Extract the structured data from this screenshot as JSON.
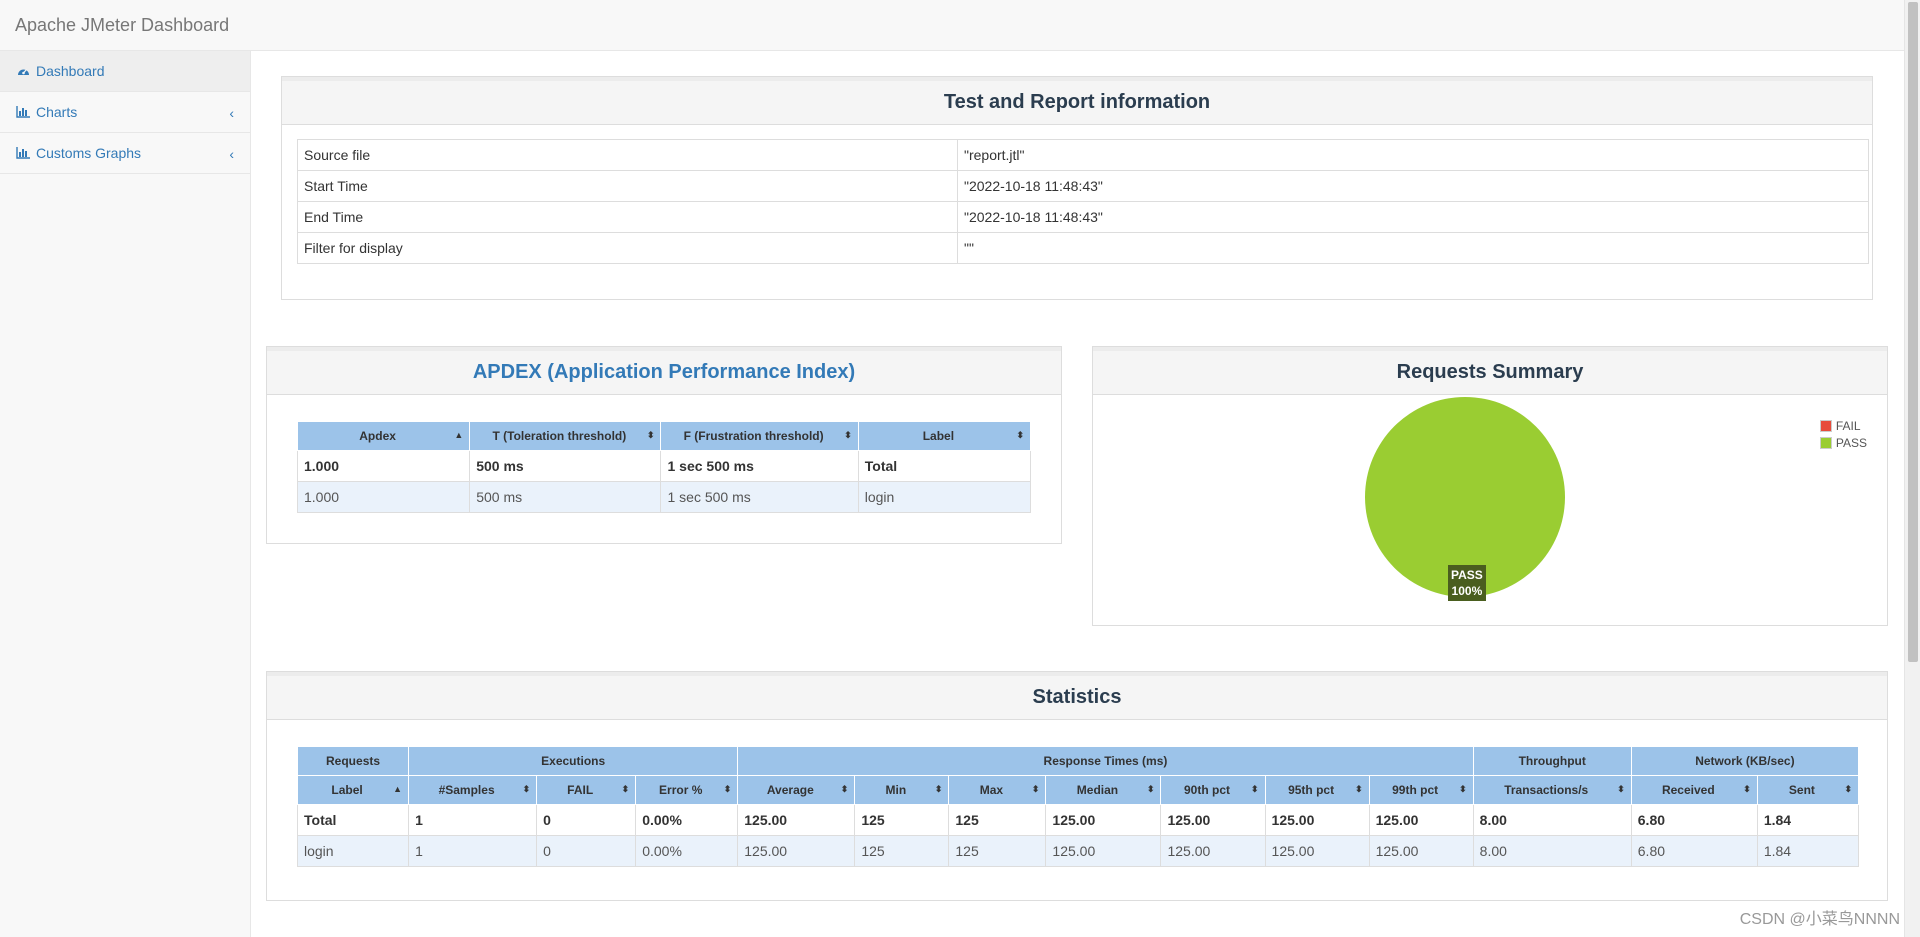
{
  "app": {
    "title": "Apache JMeter Dashboard"
  },
  "sidebar": {
    "items": [
      {
        "label": "Dashboard",
        "icon": "dashboard-icon"
      },
      {
        "label": "Charts",
        "icon": "bar-chart-icon"
      },
      {
        "label": "Customs Graphs",
        "icon": "bar-chart-icon"
      }
    ]
  },
  "report_info": {
    "title": "Test and Report information",
    "rows": [
      {
        "key": "Source file",
        "value": "\"report.jtl\""
      },
      {
        "key": "Start Time",
        "value": "\"2022-10-18 11:48:43\""
      },
      {
        "key": "End Time",
        "value": "\"2022-10-18 11:48:43\""
      },
      {
        "key": "Filter for display",
        "value": "\"\""
      }
    ]
  },
  "apdex": {
    "title": "APDEX (Application Performance Index)",
    "headers": [
      "Apdex",
      "T (Toleration threshold)",
      "F (Frustration threshold)",
      "Label"
    ],
    "rows": [
      [
        "1.000",
        "500 ms",
        "1 sec 500 ms",
        "Total"
      ],
      [
        "1.000",
        "500 ms",
        "1 sec 500 ms",
        "login"
      ]
    ]
  },
  "requests_summary": {
    "title": "Requests Summary",
    "legend": [
      {
        "label": "FAIL",
        "color": "#e74c3c"
      },
      {
        "label": "PASS",
        "color": "#9acd32"
      }
    ],
    "pie_label": "PASS",
    "pie_pct": "100%"
  },
  "chart_data": {
    "type": "pie",
    "title": "Requests Summary",
    "categories": [
      "FAIL",
      "PASS"
    ],
    "values": [
      0,
      100
    ],
    "colors": [
      "#e74c3c",
      "#9acd32"
    ],
    "legend_position": "top-right"
  },
  "statistics": {
    "title": "Statistics",
    "group_headers": [
      "Requests",
      "Executions",
      "Response Times (ms)",
      "Throughput",
      "Network (KB/sec)"
    ],
    "headers": [
      "Label",
      "#Samples",
      "FAIL",
      "Error %",
      "Average",
      "Min",
      "Max",
      "Median",
      "90th pct",
      "95th pct",
      "99th pct",
      "Transactions/s",
      "Received",
      "Sent"
    ],
    "rows": [
      [
        "Total",
        "1",
        "0",
        "0.00%",
        "125.00",
        "125",
        "125",
        "125.00",
        "125.00",
        "125.00",
        "125.00",
        "8.00",
        "6.80",
        "1.84"
      ],
      [
        "login",
        "1",
        "0",
        "0.00%",
        "125.00",
        "125",
        "125",
        "125.00",
        "125.00",
        "125.00",
        "125.00",
        "8.00",
        "6.80",
        "1.84"
      ]
    ]
  },
  "watermark": "CSDN @小菜鸟NNNN",
  "colors": {
    "link": "#337ab7",
    "header_blue": "#9cc3e9",
    "pass": "#9acd32",
    "fail": "#e74c3c"
  }
}
